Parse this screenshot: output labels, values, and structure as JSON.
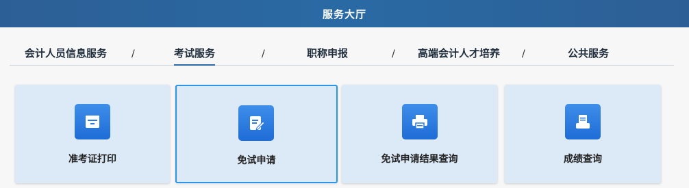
{
  "header": {
    "title": "服务大厅"
  },
  "tabs": [
    {
      "label": "会计人员信息服务",
      "active": false
    },
    {
      "label": "考试服务",
      "active": true
    },
    {
      "label": "职称申报",
      "active": false
    },
    {
      "label": "高端会计人才培养",
      "active": false
    },
    {
      "label": "公共服务",
      "active": false
    }
  ],
  "separator": "/",
  "cards": [
    {
      "label": "准考证打印",
      "icon": "print-ticket-icon"
    },
    {
      "label": "免试申请",
      "icon": "edit-document-icon",
      "selected": true
    },
    {
      "label": "免试申请结果查询",
      "icon": "printer-icon"
    },
    {
      "label": "成绩查询",
      "icon": "score-query-icon"
    }
  ],
  "colors": {
    "header_bg": "#2c5f95",
    "card_bg": "#dce9f7",
    "icon_bg": "#2a7ae2",
    "selected_border": "#2b95e8",
    "active_tab_underline": "#2b6aa8"
  }
}
